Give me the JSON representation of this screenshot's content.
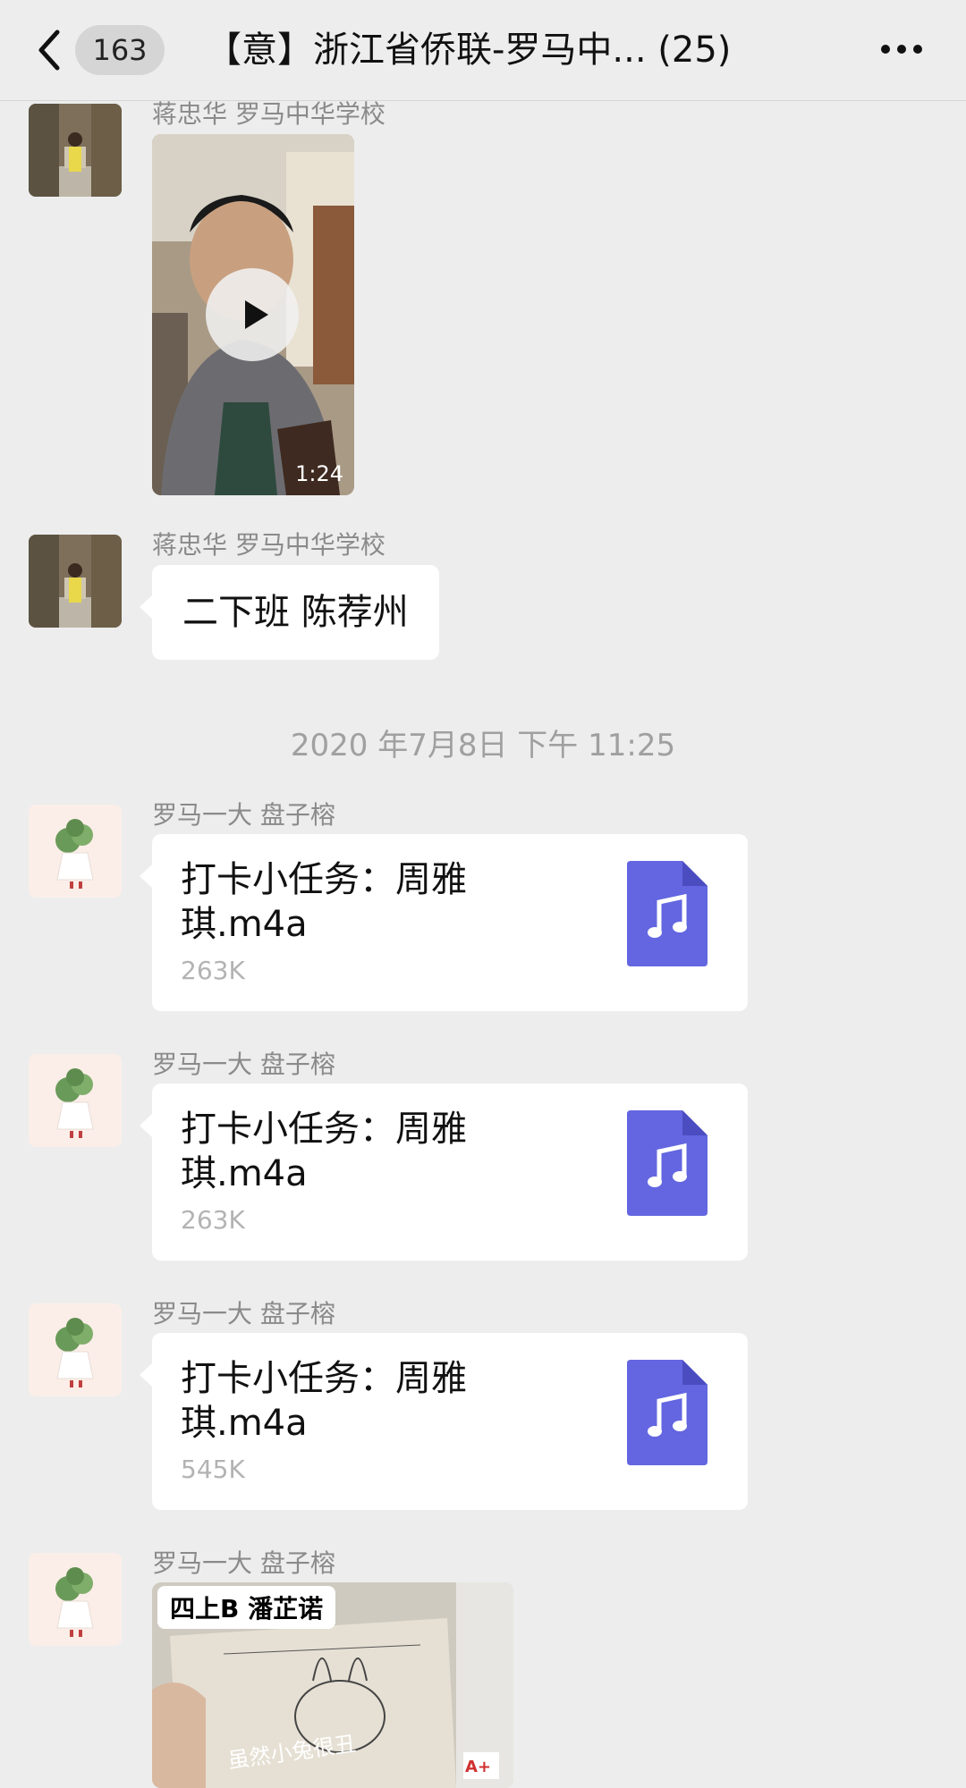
{
  "header": {
    "unread_count": "163",
    "title": "【意】浙江省侨联-罗马中... (25)"
  },
  "messages": {
    "m1": {
      "sender": "蒋忠华 罗马中华学校",
      "video_duration": "1:24"
    },
    "m2": {
      "sender": "蒋忠华 罗马中华学校",
      "text": "二下班 陈荐州"
    },
    "timestamp": "2020 年7月8日 下午 11:25",
    "m3": {
      "sender": "罗马一大 盘子榕",
      "file_name": "打卡小任务：周雅琪.m4a",
      "file_size": "263K"
    },
    "m4": {
      "sender": "罗马一大 盘子榕",
      "file_name": "打卡小任务：周雅琪.m4a",
      "file_size": "263K"
    },
    "m5": {
      "sender": "罗马一大 盘子榕",
      "file_name": "打卡小任务：周雅琪.m4a",
      "file_size": "545K"
    },
    "m6": {
      "sender": "罗马一大 盘子榕",
      "image_caption_top": "四上B 潘芷诺",
      "image_caption_bottom": "虽然小兔很丑"
    }
  },
  "colors": {
    "background": "#ededed",
    "bubble": "#ffffff",
    "file_icon": "#6366e0",
    "sender_text": "#8a8a8a"
  },
  "icons": {
    "back": "chevron-left-icon",
    "more": "more-dots-icon",
    "play": "play-icon",
    "audio_file": "music-file-icon"
  }
}
